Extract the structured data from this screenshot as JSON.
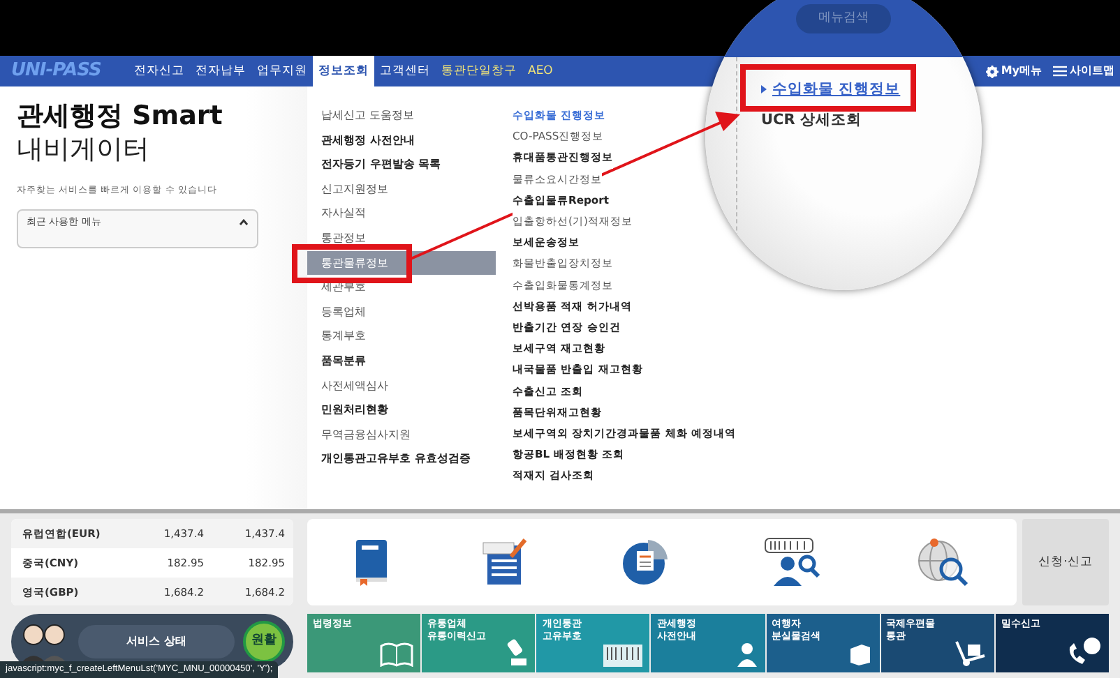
{
  "navbar": {
    "logo": "UNI-PASS",
    "tabs": [
      {
        "label": "전자신고",
        "selected": false,
        "kind": "normal"
      },
      {
        "label": "전자납부",
        "selected": false,
        "kind": "normal"
      },
      {
        "label": "업무지원",
        "selected": false,
        "kind": "normal"
      },
      {
        "label": "정보조회",
        "selected": true,
        "kind": "normal"
      },
      {
        "label": "고객센터",
        "selected": false,
        "kind": "normal"
      },
      {
        "label": "통관단일창구",
        "selected": false,
        "kind": "special"
      },
      {
        "label": "AEO",
        "selected": false,
        "kind": "special"
      }
    ],
    "my_menu": "My메뉴",
    "sitemap": "사이트맵"
  },
  "navigator": {
    "title": "관세행정 Smart",
    "subtitle": "내비게이터",
    "description": "자주찾는 서비스를 빠르게 이용할 수 있습니다",
    "recent_menu": {
      "label": "최근 사용한 메뉴",
      "expanded": true
    }
  },
  "menu_column_1": [
    {
      "label": "납세신고 도움정보",
      "bold": false,
      "selected": false
    },
    {
      "label": "관세행정 사전안내",
      "bold": true,
      "selected": false
    },
    {
      "label": "전자등기 우편발송 목록",
      "bold": true,
      "selected": false
    },
    {
      "label": "신고지원정보",
      "bold": false,
      "selected": false
    },
    {
      "label": "자사실적",
      "bold": false,
      "selected": false
    },
    {
      "label": "통관정보",
      "bold": false,
      "selected": false
    },
    {
      "label": "통관물류정보",
      "bold": false,
      "selected": true
    },
    {
      "label": "세관부호",
      "bold": false,
      "selected": false
    },
    {
      "label": "등록업체",
      "bold": false,
      "selected": false
    },
    {
      "label": "통계부호",
      "bold": false,
      "selected": false
    },
    {
      "label": "품목분류",
      "bold": true,
      "selected": false
    },
    {
      "label": "사전세액심사",
      "bold": false,
      "selected": false
    },
    {
      "label": "민원처리현황",
      "bold": true,
      "selected": false
    },
    {
      "label": "무역금융심사지원",
      "bold": false,
      "selected": false
    },
    {
      "label": "개인통관고유부호 유효성검증",
      "bold": true,
      "selected": false
    }
  ],
  "menu_column_2": [
    {
      "label": "수입화물 진행정보",
      "bold": true,
      "selected": true
    },
    {
      "label": "CO-PASS진행정보",
      "bold": false,
      "selected": false
    },
    {
      "label": "휴대품통관진행정보",
      "bold": true,
      "selected": false
    },
    {
      "label": "물류소요시간정보",
      "bold": false,
      "selected": false
    },
    {
      "label": "수출입물류Report",
      "bold": true,
      "selected": false
    },
    {
      "label": "입출항하선(기)적재정보",
      "bold": false,
      "selected": false
    },
    {
      "label": "보세운송정보",
      "bold": true,
      "selected": false
    },
    {
      "label": "화물반출입장치정보",
      "bold": false,
      "selected": false
    },
    {
      "label": "수출입화물통계정보",
      "bold": false,
      "selected": false
    },
    {
      "label": "선박용품 적재 허가내역",
      "bold": true,
      "selected": false
    },
    {
      "label": "반출기간 연장 승인건",
      "bold": true,
      "selected": false
    },
    {
      "label": "보세구역 재고현황",
      "bold": true,
      "selected": false
    },
    {
      "label": "내국물품 반출입 재고현황",
      "bold": true,
      "selected": false
    },
    {
      "label": "수출신고 조회",
      "bold": true,
      "selected": false
    },
    {
      "label": "품목단위재고현황",
      "bold": true,
      "selected": false
    },
    {
      "label": "보세구역외 장치기간경과물품 체화 예정내역",
      "bold": true,
      "selected": false
    },
    {
      "label": "항공BL 배정현황 조회",
      "bold": true,
      "selected": false
    },
    {
      "label": "적재지 검사조회",
      "bold": true,
      "selected": false
    }
  ],
  "magnifier": {
    "search_placeholder": "메뉴검색",
    "items": [
      {
        "label": "수입화물 진행정보",
        "selected": true
      },
      {
        "label": "UCR 상세조회",
        "selected": false
      }
    ]
  },
  "exchange_rates": [
    {
      "currency": "유럽연합(EUR)",
      "rate_1": "1,437.4",
      "rate_2": "1,437.4"
    },
    {
      "currency": "중국(CNY)",
      "rate_1": "182.95",
      "rate_2": "182.95"
    },
    {
      "currency": "영국(GBP)",
      "rate_1": "1,684.2",
      "rate_2": "1,684.2"
    }
  ],
  "service_status": {
    "label": "서비스 상태",
    "status": "원활"
  },
  "apply_button": "신청·신고",
  "tiles": [
    {
      "label": "법령정보",
      "color": "#3b9878"
    },
    {
      "label": "유통업체\n유통이력신고",
      "color": "#2b9a86"
    },
    {
      "label": "개인통관\n고유부호",
      "color": "#2198a6"
    },
    {
      "label": "관세행정\n사전안내",
      "color": "#1b7f9c"
    },
    {
      "label": "여행자\n분실물검색",
      "color": "#1c5f8c"
    },
    {
      "label": "국제우편물\n통관",
      "color": "#1a4a73"
    },
    {
      "label": "밀수신고",
      "color": "#0f2d4e"
    }
  ],
  "status_bar": "javascript:myc_f_createLeftMenuLst('MYC_MNU_00000450', 'Y');"
}
